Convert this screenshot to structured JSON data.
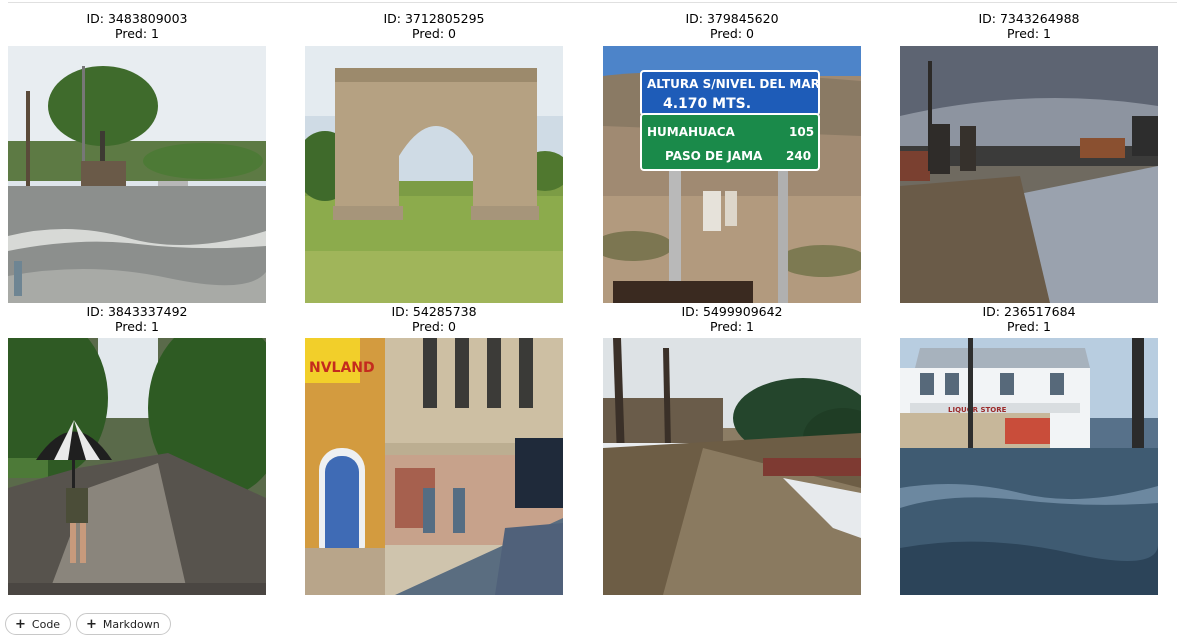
{
  "gallery": {
    "items": [
      {
        "id_text": "ID: 3483809003",
        "pred_text": "Pred: 1",
        "scene": "flooded-street-bus-stop"
      },
      {
        "id_text": "ID: 3712805295",
        "pred_text": "Pred: 0",
        "scene": "stone-arch-on-lawn"
      },
      {
        "id_text": "ID: 379845620",
        "pred_text": "Pred: 0",
        "scene": "road-sign-desert"
      },
      {
        "id_text": "ID: 7343264988",
        "pred_text": "Pred: 1",
        "scene": "flooded-road-people-walking"
      },
      {
        "id_text": "ID: 3843337492",
        "pred_text": "Pred: 1",
        "scene": "person-umbrella-flooded-street"
      },
      {
        "id_text": "ID: 54285738",
        "pred_text": "Pred: 0",
        "scene": "old-building-street"
      },
      {
        "id_text": "ID: 5499909642",
        "pred_text": "Pred: 1",
        "scene": "flooded-river-trees"
      },
      {
        "id_text": "ID: 236517684",
        "pred_text": "Pred: 1",
        "scene": "flooded-liquor-store"
      }
    ],
    "sign_text": {
      "line1": "ALTURA S/NIVEL DEL MAR",
      "line2": "4.170 MTS.",
      "line3_left": "HUMAHUACA",
      "line3_right": "105",
      "line4_left": "PASO DE JAMA",
      "line4_right": "240"
    },
    "shop_text": {
      "yellow_sign": "NVLAND",
      "store_sign": "LIQUOR STORE"
    }
  },
  "toolbar": {
    "add_code_label": "Code",
    "add_markdown_label": "Markdown"
  },
  "colors": {
    "button_border": "#c8c8c8",
    "divider": "#e0e0e0"
  }
}
